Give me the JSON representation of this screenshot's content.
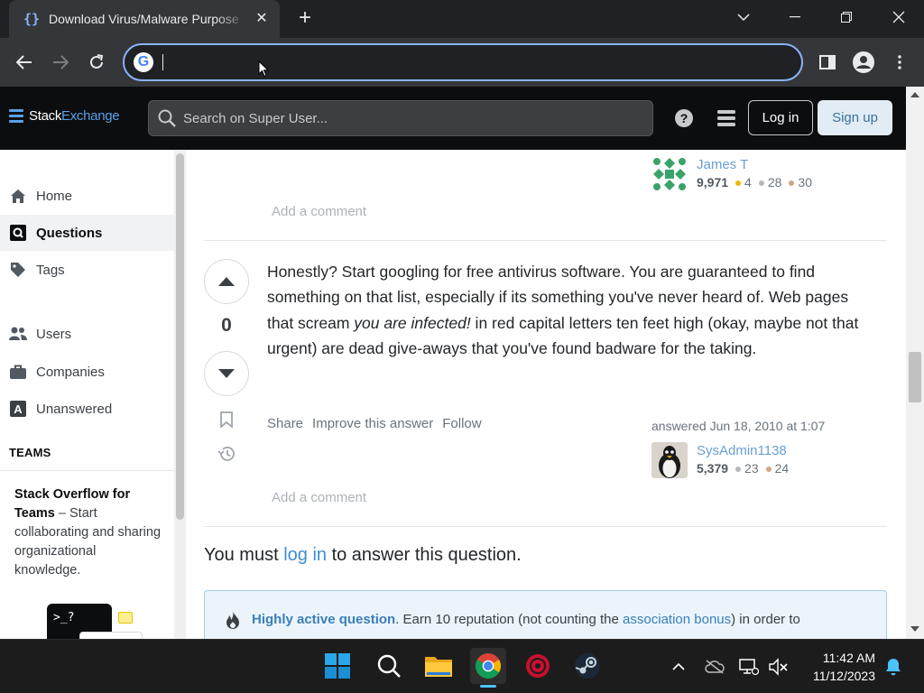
{
  "browser": {
    "tab_title": "Download Virus/Malware Purpose",
    "omnibox_value": "",
    "omnibox_placeholder": ""
  },
  "header": {
    "logo_prefix": "Stack",
    "logo_suffix": "Exchange",
    "search_placeholder": "Search on Super User...",
    "login_label": "Log in",
    "signup_label": "Sign up"
  },
  "sidebar": {
    "items": [
      {
        "label": "Home",
        "icon": "home-icon"
      },
      {
        "label": "Questions",
        "icon": "questions-icon"
      },
      {
        "label": "Tags",
        "icon": "tag-icon"
      },
      {
        "label": "Users",
        "icon": "users-icon"
      },
      {
        "label": "Companies",
        "icon": "briefcase-icon"
      },
      {
        "label": "Unanswered",
        "icon": "unanswered-icon"
      }
    ],
    "teams_label": "TEAMS",
    "teams_title": "Stack Overflow for Teams",
    "teams_text": " – Start collaborating and sharing organizational knowledge.",
    "teams_art_text": ">_?"
  },
  "prev_answer": {
    "user_name": "James T",
    "reputation": "9,971",
    "gold": "4",
    "silver": "28",
    "bronze": "30",
    "add_comment": "Add a comment"
  },
  "answer": {
    "score": "0",
    "body_1": "Honestly? Start googling for free antivirus software. You are guaranteed to find something on that list, especially if its something you've never heard of. Web pages that scream ",
    "body_em": "you are infected!",
    "body_2": " in red capital letters ten feet high (okay, maybe not that urgent) are dead give-aways that you've found badware for the taking.",
    "share": "Share",
    "improve": "Improve this answer",
    "follow": "Follow",
    "answered": "answered Jun 18, 2010 at 1:07",
    "user_name": "SysAdmin1138",
    "reputation": "5,379",
    "silver": "23",
    "bronze": "24",
    "add_comment": "Add a comment"
  },
  "login_prompt": {
    "before": "You must ",
    "link": "log in",
    "after": " to answer this question."
  },
  "notice": {
    "title": "Highly active question",
    "text_1": ". Earn 10 reputation (not counting the ",
    "link": "association bonus",
    "text_2": ") in order to"
  },
  "taskbar": {
    "time": "11:42 AM",
    "date": "11/12/2023"
  },
  "colors": {
    "accent_blue": "#8ab4f8",
    "link_blue": "#6a9ed3",
    "gold": "#f1b600",
    "silver": "#b4b8bc",
    "bronze": "#d1a684"
  }
}
